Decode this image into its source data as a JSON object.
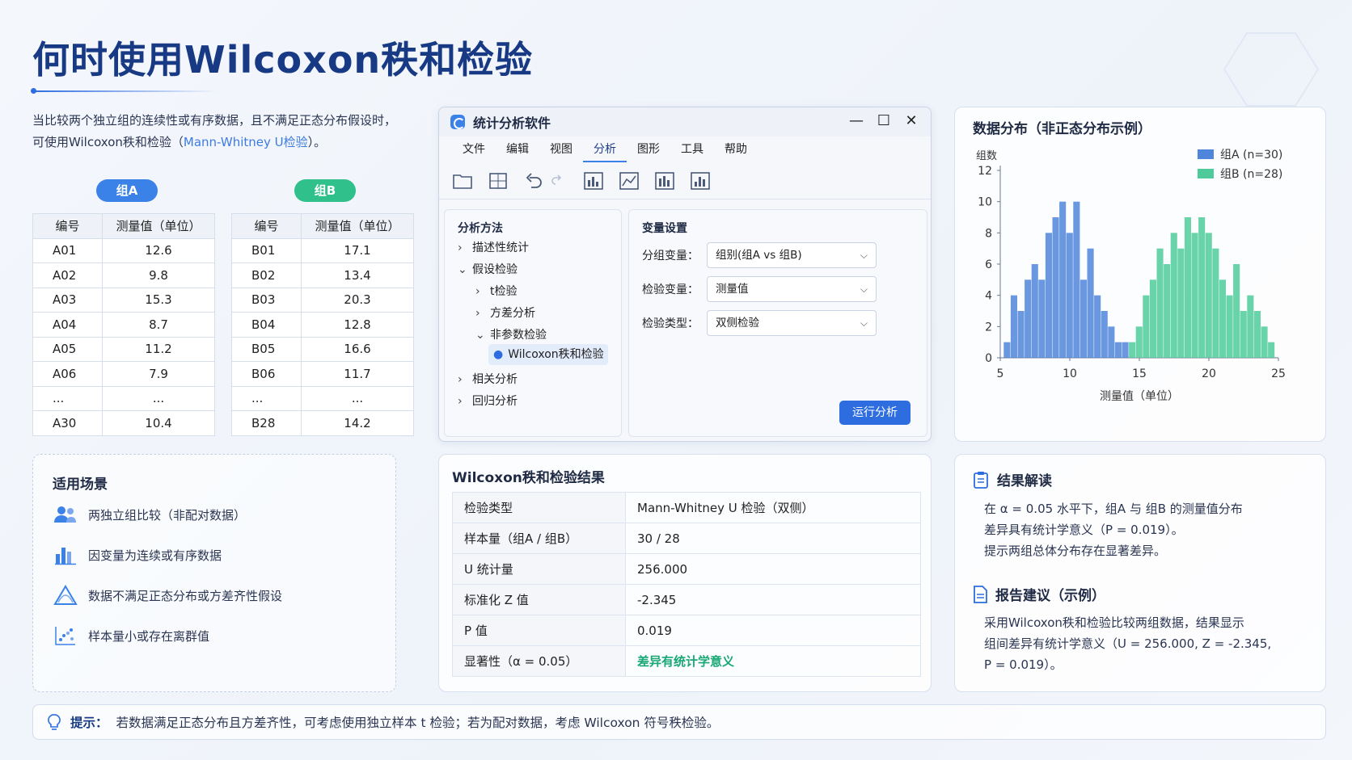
{
  "title": "何时使用Wilcoxon秩和检验",
  "intro": {
    "line1": "当比较两个独立组的连续性或有序数据，且不满足正态分布假设时，",
    "line2_a": "可使用Wilcoxon秩和检验（",
    "line2_hl": "Mann-Whitney U检验",
    "line2_b": "）。"
  },
  "groupA": {
    "label": "组A",
    "headers": [
      "编号",
      "测量值（单位）"
    ],
    "rows": [
      [
        "A01",
        "12.6"
      ],
      [
        "A02",
        "9.8"
      ],
      [
        "A03",
        "15.3"
      ],
      [
        "A04",
        "8.7"
      ],
      [
        "A05",
        "11.2"
      ],
      [
        "A06",
        "7.9"
      ],
      [
        "...",
        "..."
      ],
      [
        "A30",
        "10.4"
      ]
    ]
  },
  "groupB": {
    "label": "组B",
    "headers": [
      "编号",
      "测量值（单位）"
    ],
    "rows": [
      [
        "B01",
        "17.1"
      ],
      [
        "B02",
        "13.4"
      ],
      [
        "B03",
        "20.3"
      ],
      [
        "B04",
        "12.8"
      ],
      [
        "B05",
        "16.6"
      ],
      [
        "B06",
        "11.7"
      ],
      [
        "...",
        "..."
      ],
      [
        "B28",
        "14.2"
      ]
    ]
  },
  "scenarios": {
    "title": "适用场景",
    "items": [
      {
        "icon": "users-icon",
        "label": "两独立组比较（非配对数据）"
      },
      {
        "icon": "bar-chart-icon",
        "label": "因变量为连续或有序数据"
      },
      {
        "icon": "warning-triangle-icon",
        "label": "数据不满足正态分布或方差齐性假设"
      },
      {
        "icon": "scatter-plot-icon",
        "label": "样本量小或存在离群值"
      }
    ]
  },
  "software": {
    "title": "统计分析软件",
    "controls": {
      "minimize": "—",
      "maximize": "☐",
      "close": "✕"
    },
    "menu": [
      "文件",
      "编辑",
      "视图",
      "分析",
      "图形",
      "工具",
      "帮助"
    ],
    "active_menu": "分析",
    "left_pane_title": "分析方法",
    "tree": {
      "descriptive": "描述性统计",
      "hypothesis": "假设检验",
      "ttest": "t检验",
      "anova": "方差分析",
      "nonparam": "非参数检验",
      "wilcoxon": "Wilcoxon秩和检验",
      "correlation": "相关分析",
      "regression": "回归分析"
    },
    "right_pane_title": "变量设置",
    "fields": {
      "group_label": "分组变量：",
      "group_value": "组别(组A vs 组B)",
      "test_label": "检验变量：",
      "test_value": "测量值",
      "type_label": "检验类型：",
      "type_value": "双侧检验"
    },
    "run_button": "运行分析"
  },
  "histogram": {
    "title": "数据分布（非正态分布示例）",
    "y_unit": "组数",
    "colors": {
      "a": "#4f86dc",
      "b": "#4fcb9b"
    }
  },
  "chart_data": {
    "type": "bar",
    "title": "数据分布（非正态分布示例）",
    "xlabel": "测量值（单位）",
    "ylabel": "组数",
    "xlim": [
      5,
      25
    ],
    "ylim": [
      0,
      12
    ],
    "xticks": [
      5,
      10,
      15,
      20,
      25
    ],
    "yticks": [
      0,
      2,
      4,
      6,
      8,
      10,
      12
    ],
    "legend_position": "top-right",
    "bin_width": 0.5,
    "series": [
      {
        "name": "组A (n=30)",
        "color": "#4f86dc",
        "x": [
          5.5,
          6.0,
          6.5,
          7.0,
          7.5,
          8.0,
          8.5,
          9.0,
          9.5,
          10.0,
          10.5,
          11.0,
          11.5,
          12.0,
          12.5,
          13.0,
          13.5,
          14.0
        ],
        "values": [
          1,
          4,
          3,
          5,
          6,
          5,
          8,
          9,
          10,
          8,
          10,
          5,
          7,
          4,
          3,
          2,
          1,
          1
        ]
      },
      {
        "name": "组B (n=28)",
        "color": "#4fcb9b",
        "x": [
          14.5,
          15.0,
          15.5,
          16.0,
          16.5,
          17.0,
          17.5,
          18.0,
          18.5,
          19.0,
          19.5,
          20.0,
          20.5,
          21.0,
          21.5,
          22.0,
          22.5,
          23.0,
          23.5,
          24.0,
          24.5
        ],
        "values": [
          1,
          2,
          4,
          5,
          7,
          6,
          8,
          7,
          9,
          8,
          9,
          8,
          7,
          5,
          4,
          6,
          3,
          4,
          3,
          2,
          1
        ]
      }
    ]
  },
  "results": {
    "title": "Wilcoxon秩和检验结果",
    "rows": [
      [
        "检验类型",
        "Mann-Whitney U 检验（双侧）"
      ],
      [
        "样本量（组A / 组B）",
        "30 / 28"
      ],
      [
        "U 统计量",
        "256.000"
      ],
      [
        "标准化 Z 值",
        "-2.345"
      ],
      [
        "P 值",
        "0.019"
      ],
      [
        "显著性（α = 0.05）",
        "差异有统计学意义"
      ]
    ]
  },
  "interpretation": {
    "title": "结果解读",
    "line1": "在 α = 0.05 水平下，组A 与 组B 的测量值分布",
    "line2": "差异具有统计学意义（P = 0.019）。",
    "line3": "提示两组总体分布存在显著差异。"
  },
  "report": {
    "title": "报告建议（示例）",
    "line1": "采用Wilcoxon秩和检验比较两组数据，结果显示",
    "line2": "组间差异有统计学意义（U = 256.000, Z = -2.345,",
    "line3": "P = 0.019）。"
  },
  "tip": {
    "label": "提示：",
    "text": "若数据满足正态分布且方差齐性，可考虑使用独立样本 t 检验；若为配对数据，考虑 Wilcoxon 符号秩检验。"
  }
}
